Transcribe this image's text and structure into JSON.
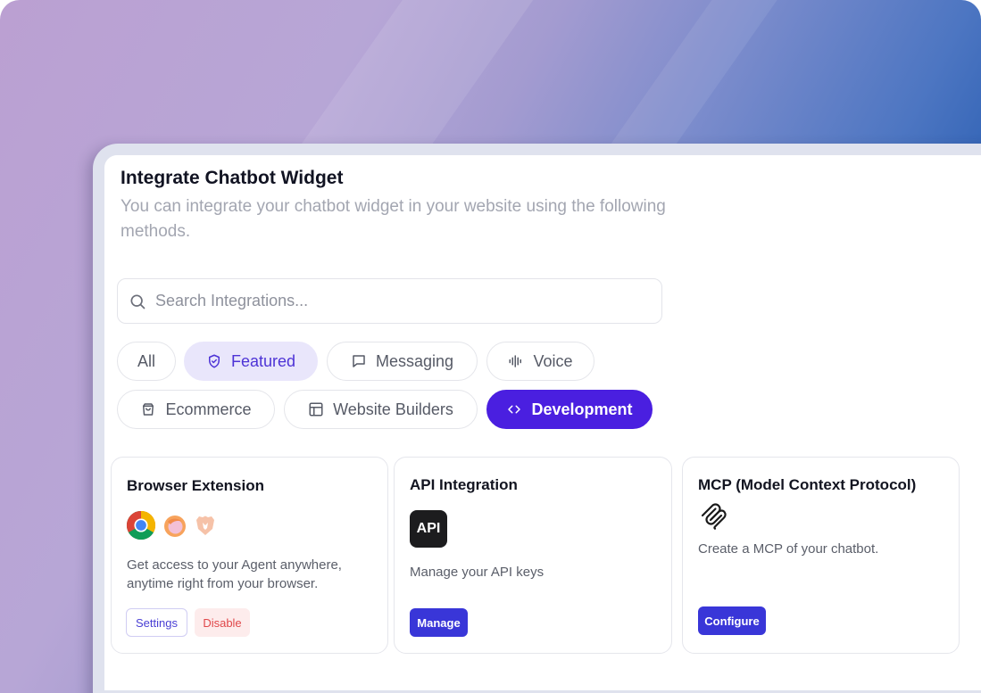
{
  "header": {
    "title": "Integrate Chatbot Widget",
    "subtitle": "You can integrate your chatbot widget in your website using the following methods."
  },
  "search": {
    "placeholder": "Search Integrations...",
    "value": ""
  },
  "filters": [
    {
      "label": "All",
      "icon": "",
      "state": "default"
    },
    {
      "label": "Featured",
      "icon": "shield-check-icon",
      "state": "highlighted"
    },
    {
      "label": "Messaging",
      "icon": "chat-bubble-icon",
      "state": "default"
    },
    {
      "label": "Voice",
      "icon": "audio-wave-icon",
      "state": "default"
    },
    {
      "label": "Ecommerce",
      "icon": "shopping-bag-icon",
      "state": "default"
    },
    {
      "label": "Website Builders",
      "icon": "layout-icon",
      "state": "default"
    },
    {
      "label": "Development",
      "icon": "code-icon",
      "state": "active"
    }
  ],
  "cards": [
    {
      "title": "Browser Extension",
      "icons": [
        "chrome-icon",
        "firefox-icon",
        "brave-icon"
      ],
      "description": "Get access to your Agent anywhere, anytime right from your browser.",
      "buttons": [
        {
          "label": "Settings",
          "style": "outline"
        },
        {
          "label": "Disable",
          "style": "danger"
        }
      ]
    },
    {
      "title": "API Integration",
      "tile_label": "API",
      "description": "Manage your API keys",
      "buttons": [
        {
          "label": "Manage",
          "style": "primary"
        }
      ]
    },
    {
      "title": "MCP (Model Context Protocol)",
      "icons": [
        "mcp-icon"
      ],
      "description": "Create a MCP of your chatbot.",
      "buttons": [
        {
          "label": "Configure",
          "style": "primary"
        }
      ]
    }
  ],
  "colors": {
    "accent": "#4a1fe0",
    "primary_button": "#3936d8",
    "featured_bg": "#e9e6fb",
    "danger_text": "#e0474a"
  }
}
